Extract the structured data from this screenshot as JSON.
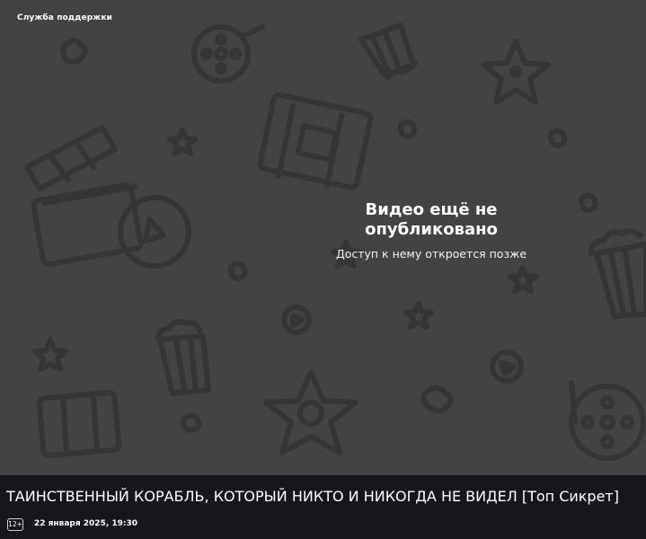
{
  "player": {
    "support_link": "Служба поддержки",
    "notice_title": "Видео ещё не опубликовано",
    "notice_subtitle": "Доступ к нему откроется позже"
  },
  "video": {
    "title": "ТАИНСТВЕННЫЙ КОРАБЛЬ, КОТОРЫЙ НИКТО И НИКОГДА НЕ ВИДЕЛ [Топ Сикрет]",
    "age_rating": "12+",
    "published": "22 января 2025, 19:30"
  },
  "colors": {
    "page_background": "#15171c",
    "player_background": "#434343",
    "pattern_icons": "#353535"
  },
  "background_pattern_icons": [
    "film-reel-icon",
    "popcorn-icon",
    "star-icon",
    "film-strip-icon",
    "clapperboard-icon",
    "play-circle-icon"
  ]
}
